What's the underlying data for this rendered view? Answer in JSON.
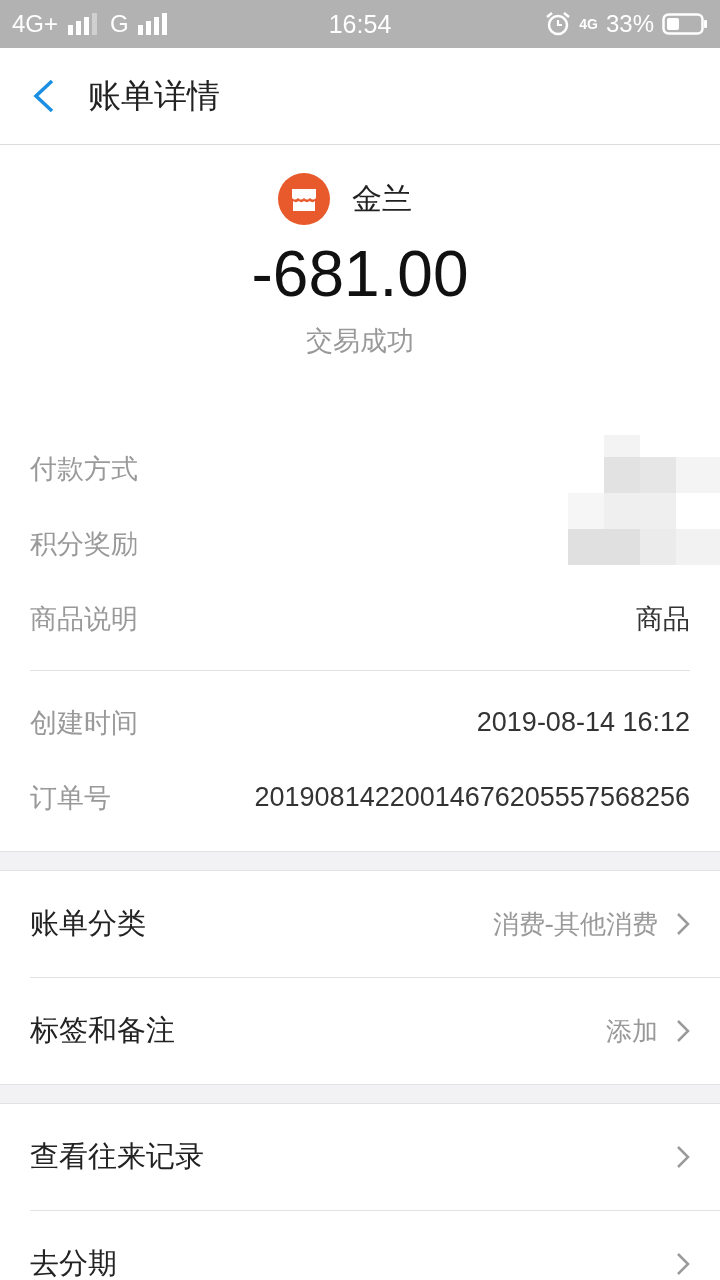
{
  "status_bar": {
    "network_1": "4G+",
    "network_2": "G",
    "time": "16:54",
    "data_network": "4G",
    "battery": "33%"
  },
  "header": {
    "title": "账单详情"
  },
  "summary": {
    "merchant": "金兰",
    "amount": "-681.00",
    "status": "交易成功"
  },
  "details": [
    {
      "label": "付款方式",
      "kind": "redacted"
    },
    {
      "label": "积分奖励",
      "kind": "redacted"
    },
    {
      "label": "商品说明",
      "value": "商品",
      "kind": "text"
    },
    {
      "kind": "divider"
    },
    {
      "label": "创建时间",
      "value": "2019-08-14 16:12",
      "kind": "text"
    },
    {
      "label": "订单号",
      "value": "20190814220014676205557568256",
      "kind": "text"
    }
  ],
  "sections": [
    [
      {
        "label": "账单分类",
        "value": "消费-其他消费"
      },
      {
        "label": "标签和备注",
        "value": "添加"
      }
    ],
    [
      {
        "label": "查看往来记录"
      },
      {
        "label": "去分期"
      }
    ]
  ]
}
